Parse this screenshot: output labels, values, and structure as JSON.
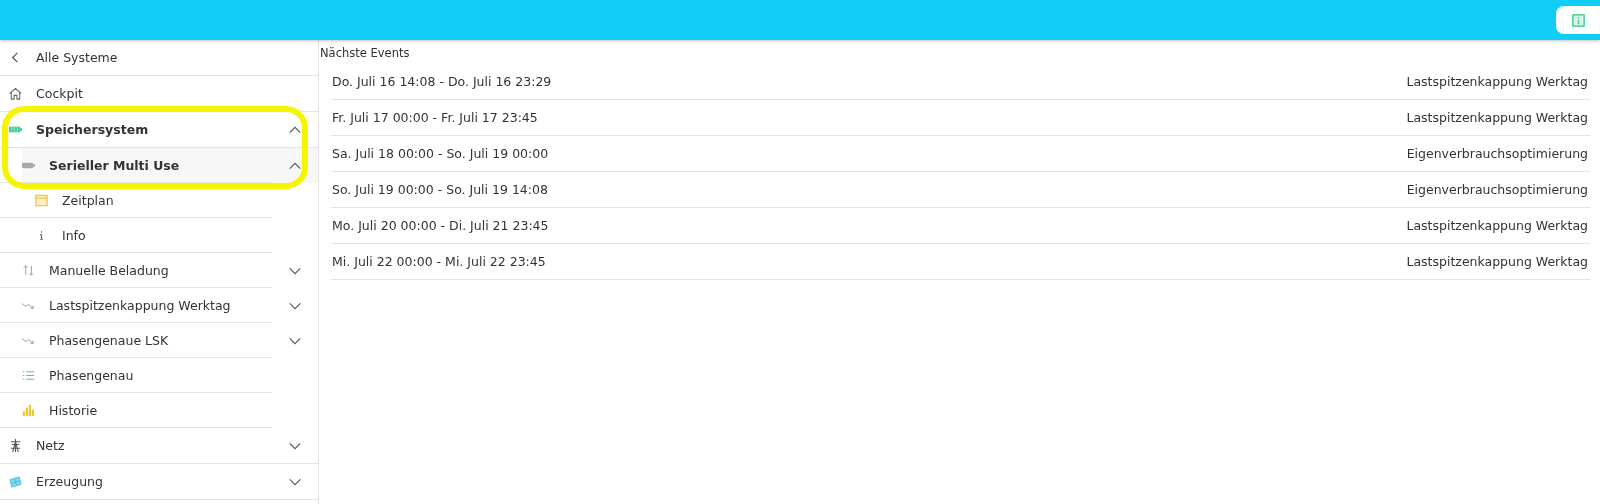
{
  "header": {
    "info_button": true
  },
  "sidebar": {
    "items": [
      {
        "kind": "back",
        "label": "Alle Systeme"
      },
      {
        "kind": "home",
        "label": "Cockpit"
      },
      {
        "kind": "battery",
        "label": "Speichersystem",
        "expanded": true,
        "highlighted": true,
        "children": [
          {
            "kind": "battery-gray",
            "label": "Serieller Multi Use",
            "expanded": true,
            "highlighted": true,
            "children": [
              {
                "kind": "calendar",
                "label": "Zeitplan"
              },
              {
                "kind": "info",
                "label": "Info"
              }
            ]
          },
          {
            "kind": "updown",
            "label": "Manuelle Beladung",
            "expanded": false
          },
          {
            "kind": "trend",
            "label": "Lastspitzenkappung Werktag",
            "expanded": false
          },
          {
            "kind": "trend",
            "label": "Phasengenaue LSK",
            "expanded": false
          },
          {
            "kind": "list",
            "label": "Phasengenau"
          },
          {
            "kind": "bars",
            "label": "Historie"
          }
        ]
      },
      {
        "kind": "tower",
        "label": "Netz",
        "expanded": false
      },
      {
        "kind": "solar",
        "label": "Erzeugung",
        "expanded": false
      }
    ]
  },
  "events": {
    "title": "Nächste Events",
    "rows": [
      {
        "time": "Do. Juli 16 14:08 - Do. Juli 16 23:29",
        "mode": "Lastspitzenkappung Werktag"
      },
      {
        "time": "Fr. Juli 17 00:00 - Fr. Juli 17 23:45",
        "mode": "Lastspitzenkappung Werktag"
      },
      {
        "time": "Sa. Juli 18 00:00 - So. Juli 19 00:00",
        "mode": "Eigenverbrauchsoptimierung"
      },
      {
        "time": "So. Juli 19 00:00 - So. Juli 19 14:08",
        "mode": "Eigenverbrauchsoptimierung"
      },
      {
        "time": "Mo. Juli 20 00:00 - Di. Juli 21 23:45",
        "mode": "Lastspitzenkappung Werktag"
      },
      {
        "time": "Mi. Juli 22 00:00 - Mi. Juli 22 23:45",
        "mode": "Lastspitzenkappung Werktag"
      }
    ]
  }
}
